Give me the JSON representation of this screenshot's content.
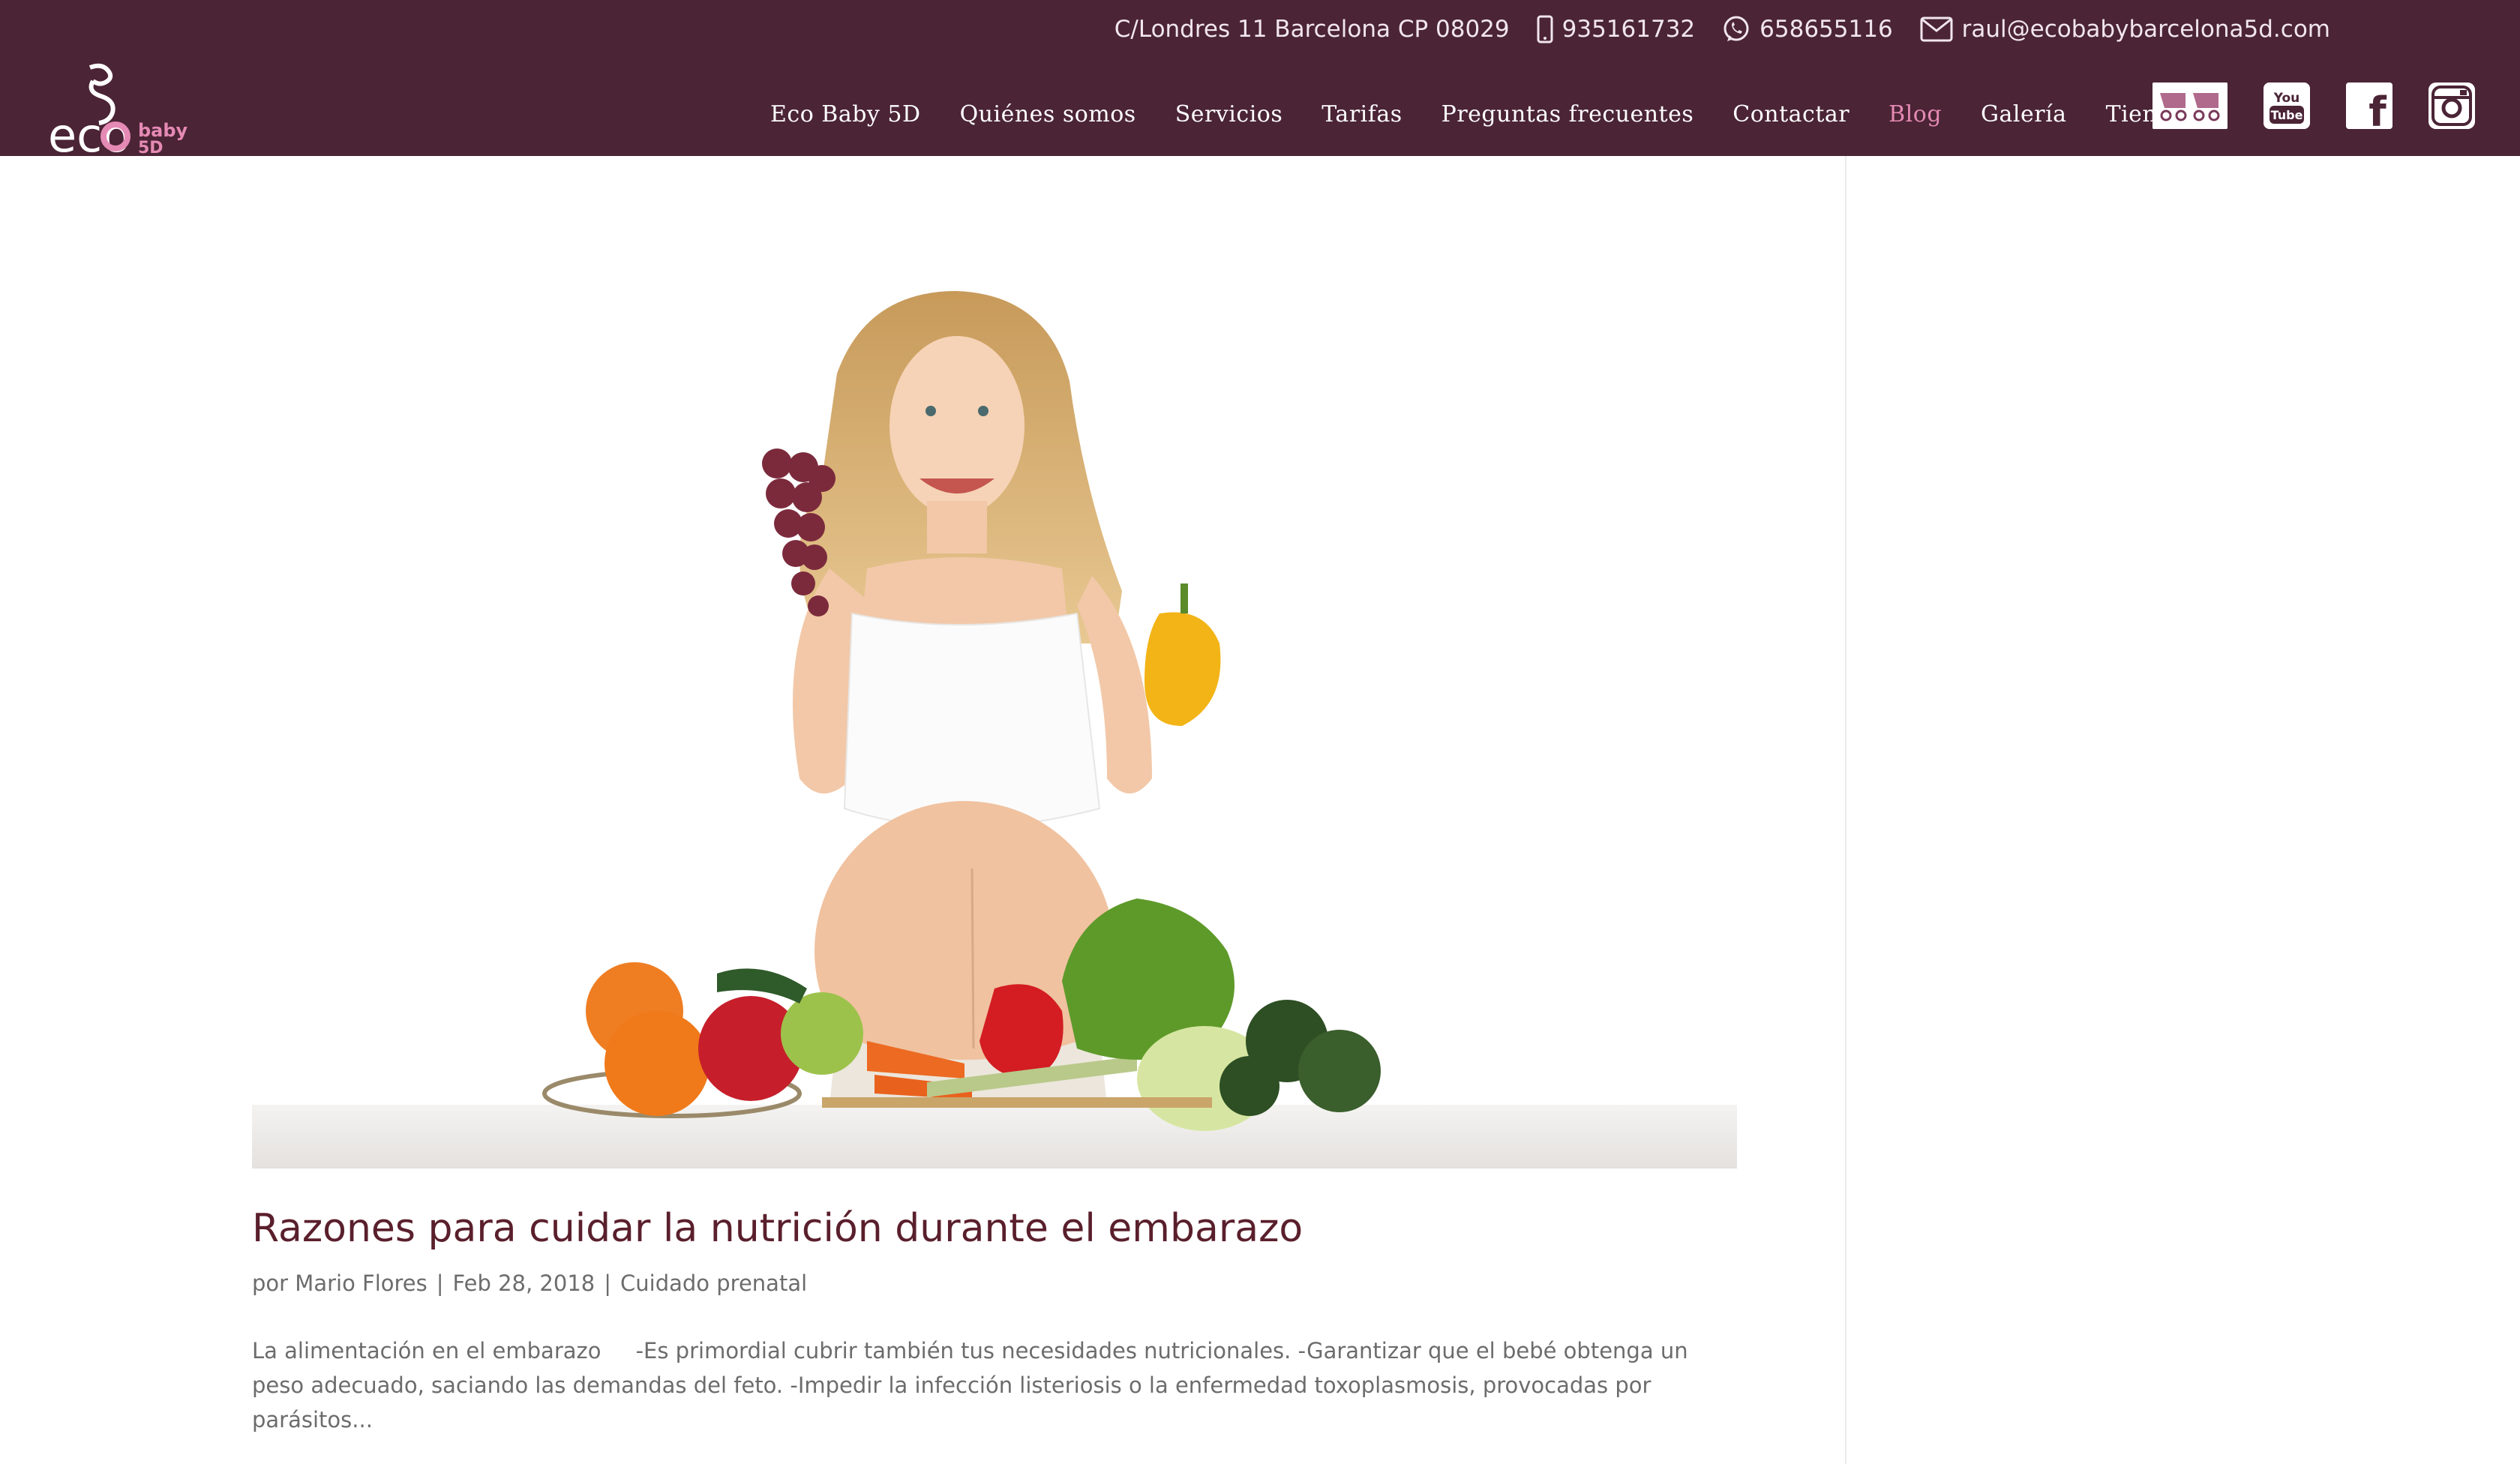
{
  "topbar": {
    "address": "C/Londres 11 Barcelona CP 08029",
    "phone": "935161732",
    "whatsapp": "658655116",
    "email": "raul@ecobabybarcelona5d.com"
  },
  "logo": {
    "main": "eco",
    "sub1": "baby",
    "sub2": "5D"
  },
  "nav": {
    "items": [
      {
        "label": "Eco Baby 5D"
      },
      {
        "label": "Quiénes somos"
      },
      {
        "label": "Servicios"
      },
      {
        "label": "Tarifas"
      },
      {
        "label": "Preguntas frecuentes"
      },
      {
        "label": "Contactar"
      },
      {
        "label": "Blog",
        "active": true
      },
      {
        "label": "Galería"
      },
      {
        "label": "Tienda"
      }
    ]
  },
  "social": {
    "youtube_line1": "You",
    "youtube_line2": "Tube",
    "facebook": "f"
  },
  "post": {
    "title": "Razones para cuidar la nutrición durante el embarazo",
    "meta_prefix": "por",
    "author": "Mario Flores",
    "date": "Feb 28, 2018",
    "category": "Cuidado prenatal",
    "excerpt": "La alimentación en el embarazo     -Es primordial cubrir también tus necesidades nutricionales. -Garantizar que el bebé obtenga un peso adecuado, saciando las demandas del feto. -Impedir la infección listeriosis o la enfermedad toxoplasmosis, provocadas por parásitos..."
  },
  "colors": {
    "header_bg": "#4b2436",
    "accent_pink": "#e58ab4",
    "title": "#5a1f2c",
    "body_text": "#6c6c6c"
  }
}
